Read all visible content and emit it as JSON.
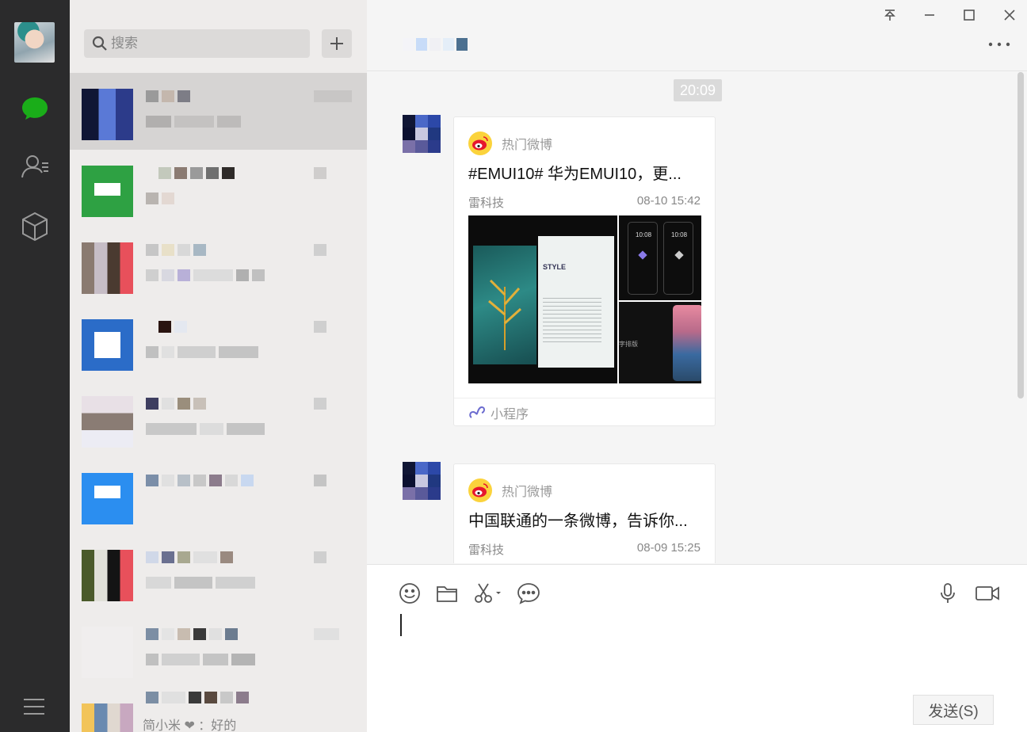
{
  "search": {
    "placeholder": "搜索"
  },
  "conversations": {
    "last_preview": "简小米 ❤ ：好的"
  },
  "chat": {
    "time": "20:09",
    "messages": [
      {
        "source": "热门微博",
        "title": "#EMUI10# 华为EMUI10，更...",
        "author": "雷科技",
        "date": "08-10 15:42",
        "footer": "小程序",
        "img_phone_time_1": "10:08",
        "img_phone_time_2": "10:08",
        "img_book_label": "STYLE",
        "img_caption": "字排版"
      },
      {
        "source": "热门微博",
        "title": "中国联通的一条微博，告诉你...",
        "author": "雷科技",
        "date": "08-09 15:25"
      }
    ],
    "send_label": "发送(S)"
  },
  "colors": {
    "accent_green": "#1aad19",
    "weibo_red": "#e6162d",
    "weibo_yellow": "#fbd33c"
  }
}
